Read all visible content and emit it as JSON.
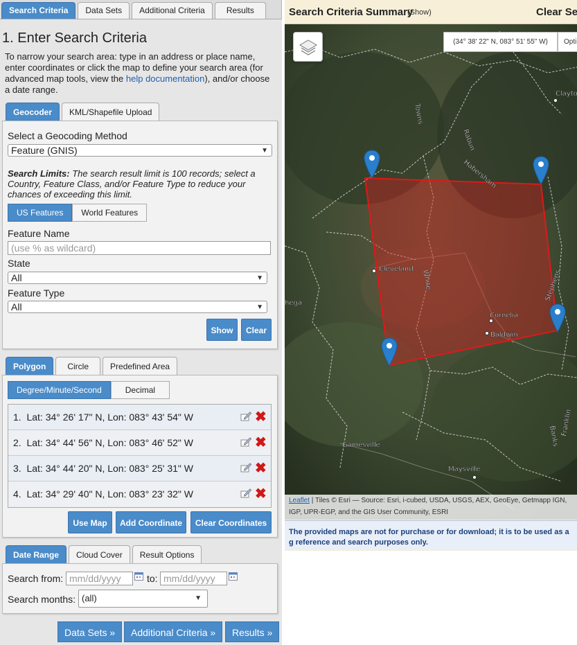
{
  "main_tabs": [
    "Search Criteria",
    "Data Sets",
    "Additional Criteria",
    "Results"
  ],
  "section_title": "1. Enter Search Criteria",
  "intro": {
    "before": "To narrow your search area: type in an address or place name, enter coordinates or click the map to define your search area (for advanced map tools, view the ",
    "link": "help documentation",
    "after": "), and/or choose a date range."
  },
  "geo_tabs": [
    "Geocoder",
    "KML/Shapefile Upload"
  ],
  "geocoder": {
    "method_label": "Select a Geocoding Method",
    "method_value": "Feature (GNIS)",
    "limits_bold": "Search Limits:",
    "limits_text": " The search result limit is 100 records; select a Country, Feature Class, and/or Feature Type to reduce your chances of exceeding this limit.",
    "feature_toggle": [
      "US Features",
      "World Features"
    ],
    "feature_name_label": "Feature Name",
    "feature_name_placeholder": "(use % as wildcard)",
    "state_label": "State",
    "state_value": "All",
    "feature_type_label": "Feature Type",
    "feature_type_value": "All",
    "show_btn": "Show",
    "clear_btn": "Clear"
  },
  "area_tabs": [
    "Polygon",
    "Circle",
    "Predefined Area"
  ],
  "coord_format": [
    "Degree/Minute/Second",
    "Decimal"
  ],
  "coordinates": [
    {
      "num": "1.",
      "text": "Lat: 34° 26' 17\" N, Lon: 083° 43' 54\" W"
    },
    {
      "num": "2.",
      "text": "Lat: 34° 44' 56\" N, Lon: 083° 46' 52\" W"
    },
    {
      "num": "3.",
      "text": "Lat: 34° 44' 20\" N, Lon: 083° 25' 31\" W"
    },
    {
      "num": "4.",
      "text": "Lat: 34° 29' 40\" N, Lon: 083° 23' 32\" W"
    }
  ],
  "coord_buttons": [
    "Use Map",
    "Add Coordinate",
    "Clear Coordinates"
  ],
  "date_tabs": [
    "Date Range",
    "Cloud Cover",
    "Result Options"
  ],
  "date": {
    "from_label": "Search from:",
    "from_placeholder": "mm/dd/yyyy",
    "to_label": "to:",
    "to_placeholder": "mm/dd/yyyy",
    "months_label": "Search months:",
    "months_value": "(all)"
  },
  "nav_buttons": [
    "Data Sets »",
    "Additional Criteria »",
    "Results »"
  ],
  "summary": {
    "title": "Search Criteria Summary",
    "show": "(Show)",
    "clear": "Clear Sea"
  },
  "map": {
    "cursor_coords": "(34° 38' 22\" N, 083° 51' 55\" W)",
    "options": "Opti",
    "places": [
      "Cleveland",
      "Cornelia",
      "Baldwin",
      "Gainesville",
      "Maysville",
      "Clayto",
      "White",
      "Habersham",
      "Rabun",
      "Towns",
      "Stephens",
      "Banks",
      "Franklin",
      "hega"
    ],
    "attribution_link": "Leaflet",
    "attribution_text": " | Tiles © Esri — Source: Esri, i-cubed, USDA, USGS, AEX, GeoEye, Getmapp IGN, IGP, UPR-EGP, and the GIS User Community, ESRI",
    "polygon_color": "#d42020"
  },
  "notice": "The provided maps are not for purchase or for download; it is to be used as a g reference and search purposes only."
}
